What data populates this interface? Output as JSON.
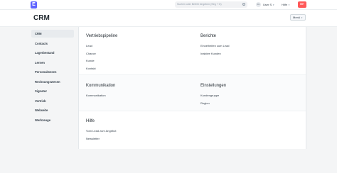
{
  "navbar": {
    "logo": "E",
    "search_placeholder": "Suchen oder Befehl eingeben (Strg + G)",
    "avatar_initials": "SU",
    "user_label": "User S",
    "help_label": "Hilfe",
    "notification_label": "99+"
  },
  "header": {
    "title": "CRM",
    "menu_label": "Menü"
  },
  "sidebar": {
    "items": [
      {
        "label": "CRM"
      },
      {
        "label": "Contacts"
      },
      {
        "label": "Lagerbestand"
      },
      {
        "label": "Lernen"
      },
      {
        "label": "Personalwesen"
      },
      {
        "label": "Rechnungswesen"
      },
      {
        "label": "Signatur"
      },
      {
        "label": "Vertrieb"
      },
      {
        "label": "Webseite"
      },
      {
        "label": "Werkzeuge"
      }
    ]
  },
  "main": {
    "sections": [
      {
        "left": {
          "title": "Vertriebspipeline",
          "links": [
            "Lead",
            "Chance",
            "Kunde",
            "Kontakt"
          ]
        },
        "right": {
          "title": "Berichte",
          "links": [
            "Einzelheiten zum Lead",
            "Inaktive Kunden"
          ]
        }
      },
      {
        "left": {
          "title": "Kommunikation",
          "links": [
            "Kommunikation"
          ]
        },
        "right": {
          "title": "Einstellungen",
          "links": [
            "Kundengruppe",
            "Region"
          ]
        }
      },
      {
        "left": {
          "title": "Hilfe",
          "links": [
            "Vom Lead zum Angebot",
            "Newsletter"
          ]
        }
      }
    ]
  }
}
